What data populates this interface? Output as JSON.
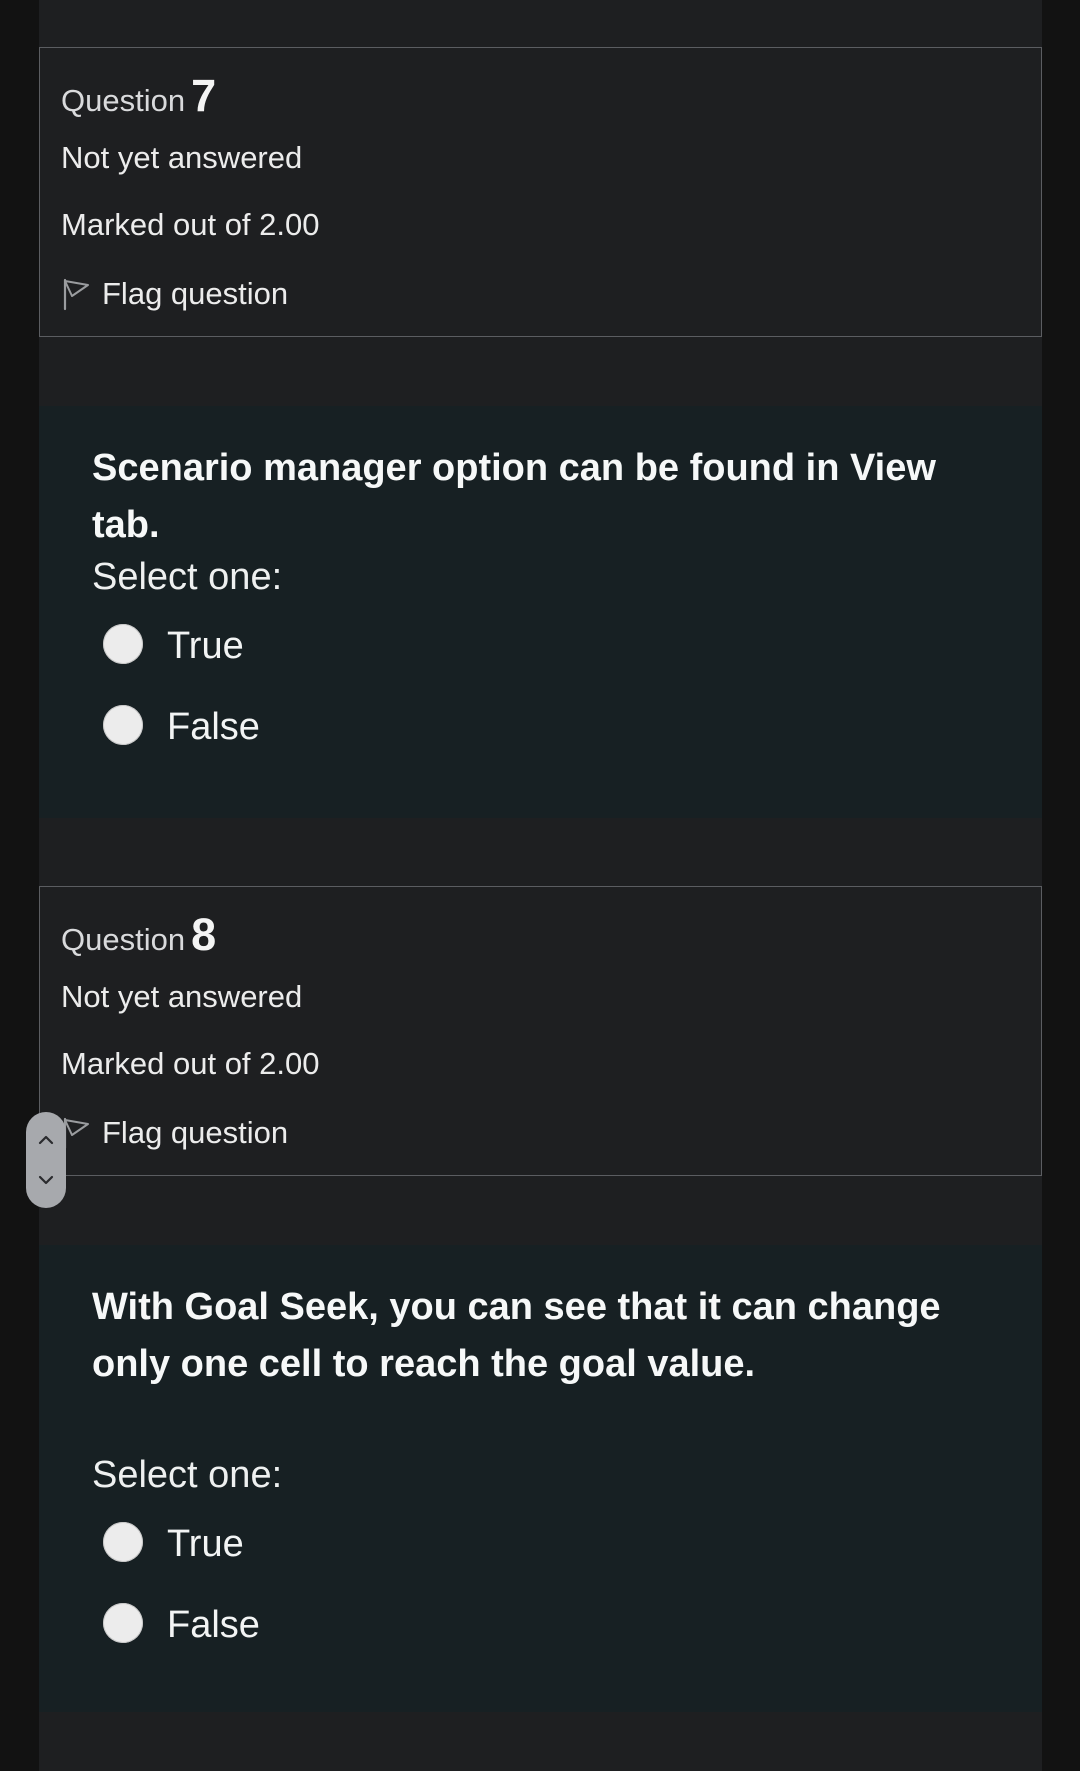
{
  "questions": [
    {
      "label": "Question",
      "number": "7",
      "state": "Not yet answered",
      "grade": "Marked out of 2.00",
      "flag_label": "Flag question",
      "text": "Scenario manager option can be found in View tab.",
      "prompt": "Select one:",
      "options": [
        {
          "label": "True",
          "selected": false
        },
        {
          "label": "False",
          "selected": false
        }
      ]
    },
    {
      "label": "Question",
      "number": "8",
      "state": "Not yet answered",
      "grade": "Marked out of 2.00",
      "flag_label": "Flag question",
      "text": "With Goal Seek, you can see that it can change only one cell to reach the goal value.",
      "prompt": "Select one:",
      "options": [
        {
          "label": "True",
          "selected": false
        },
        {
          "label": "False",
          "selected": false
        }
      ]
    }
  ],
  "icons": {
    "flag": "flag-outline-icon",
    "scroll_up": "chevron-up-icon",
    "scroll_down": "chevron-down-icon"
  },
  "colors": {
    "page_background": "#1e1f21",
    "content_background": "#172023",
    "info_border": "#5b5d61",
    "radio_fill": "#ececec"
  }
}
